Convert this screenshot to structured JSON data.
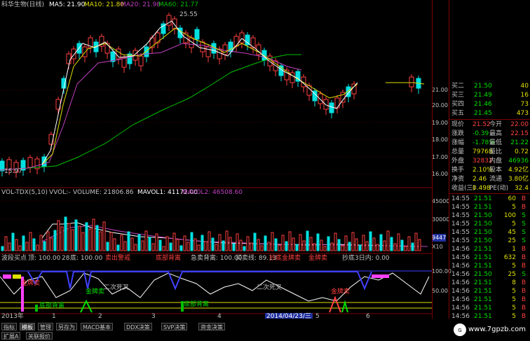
{
  "header": {
    "stock_name": "科华生物(日线)",
    "ma5": "MA5: 21.90",
    "ma10": "MA10: 21.80",
    "ma20": "MA20: 21.98",
    "ma60": "MA60: 21.77",
    "high_marker": "25.55",
    "low_marker": "15.97"
  },
  "price_axis": [
    "21.00",
    "20.00",
    "19.00",
    "18.00",
    "17.00",
    "16.00"
  ],
  "volume_panel": {
    "title": "VOL-TDX(5,10)",
    "vvol": "VVOL:-",
    "volume": "VOLUME: 21806.86",
    "mavol1": "MAVOL1: 41172.00",
    "mavol2": "MAVOL2: 46508.60",
    "axis": [
      "45000",
      "30000",
      "X10"
    ],
    "last_box": "9447"
  },
  "indicator_panel": {
    "l1": "波段买点",
    "l2": "顶: 100.00",
    "l3": "28",
    "l4": "底: 100.00",
    "l5": "卖出警戒",
    "l6": "底部背离",
    "l7": "急卖背离: 100.00",
    "l8": "买卖线: 89.13",
    "l9": "抄底",
    "l10": "金牌卖",
    "l11": "金牌卖",
    "l12": "抄底3日内: 0.00",
    "axis": [
      "100.00",
      "50.00"
    ],
    "ann1": "二次死叉",
    "ann2": "二次死叉",
    "ann3": "金牌卖",
    "ann4": "金牌卖",
    "ann5": "金牌卖",
    "ann6": "底部背离",
    "ann7": "底部背离"
  },
  "timeline": {
    "year": "2013年",
    "m1": "1",
    "m2": "2",
    "m3": "3",
    "m4": "4",
    "m5": "5",
    "m6": "6",
    "date_box": "2014/04/23/三"
  },
  "order_book": [
    {
      "label": "买二",
      "price": "21.50",
      "vol": "40"
    },
    {
      "label": "买三",
      "price": "21.49",
      "vol": "16"
    },
    {
      "label": "买四",
      "price": "21.46",
      "vol": "73"
    },
    {
      "label": "买五",
      "price": "21.45",
      "vol": "473"
    }
  ],
  "quote": [
    {
      "l1": "现价",
      "v1": "21.52",
      "c1": "#ff4040",
      "l2": "今开",
      "v2": "22.00",
      "c2": "#ff4040"
    },
    {
      "l1": "涨跌",
      "v1": "-0.39",
      "c1": "#00e000",
      "l2": "最高",
      "v2": "22.15",
      "c2": "#ff4040"
    },
    {
      "l1": "涨幅",
      "v1": "-1.78%",
      "c1": "#00e000",
      "l2": "最低",
      "v2": "21.22",
      "c2": "#00e000"
    },
    {
      "l1": "总量",
      "v1": "79768",
      "c1": "#e0e000",
      "l2": "量比",
      "v2": "0.72",
      "c2": "#e0e000"
    },
    {
      "l1": "外盘",
      "v1": "32832",
      "c1": "#ff4040",
      "l2": "内盘",
      "v2": "46936",
      "c2": "#00e000"
    },
    {
      "l1": "换手",
      "v1": "2.10%",
      "c1": "#e0e000",
      "l2": "股本",
      "v2": "4.92亿",
      "c2": "#e0e000"
    },
    {
      "l1": "净资",
      "v1": "2.46",
      "c1": "#e0e000",
      "l2": "流通",
      "v2": "3.80亿",
      "c2": "#e0e000"
    },
    {
      "l1": "收益(三)",
      "v1": "0.498",
      "c1": "#e0e000",
      "l2": "PE(动)",
      "v2": "32.4",
      "c2": "#e0e000"
    }
  ],
  "ticks": [
    {
      "t": "14:55",
      "p": "21.51",
      "v": "60",
      "bs": "B",
      "pc": "#00e000",
      "bc": "#ff4040"
    },
    {
      "t": "14:55",
      "p": "21.51",
      "v": "5",
      "bs": "B",
      "pc": "#00e000",
      "bc": "#ff4040"
    },
    {
      "t": "14:55",
      "p": "21.50",
      "v": "100",
      "bs": "S",
      "pc": "#00e000",
      "bc": "#00e000"
    },
    {
      "t": "14:55",
      "p": "21.50",
      "v": "5",
      "bs": "S",
      "pc": "#00e000",
      "bc": "#00e000"
    },
    {
      "t": "14:55",
      "p": "21.50",
      "v": "45",
      "bs": "S",
      "pc": "#00e000",
      "bc": "#00e000"
    },
    {
      "t": "14:55",
      "p": "21.50",
      "v": "25",
      "bs": "S",
      "pc": "#00e000",
      "bc": "#00e000"
    },
    {
      "t": "14:56",
      "p": "21.51",
      "v": "1",
      "bs": "B",
      "pc": "#00e000",
      "bc": "#ff4040"
    },
    {
      "t": "14:56",
      "p": "21.51",
      "v": "632",
      "bs": "B",
      "pc": "#00e000",
      "bc": "#ff4040"
    },
    {
      "t": "14:56",
      "p": "21.51",
      "v": "5",
      "bs": "B",
      "pc": "#00e000",
      "bc": "#ff4040"
    },
    {
      "t": "14:56",
      "p": "21.50",
      "v": "25",
      "bs": "S",
      "pc": "#00e000",
      "bc": "#00e000"
    },
    {
      "t": "14:56",
      "p": "21.51",
      "v": "8",
      "bs": "B",
      "pc": "#00e000",
      "bc": "#ff4040"
    },
    {
      "t": "14:56",
      "p": "21.51",
      "v": "5",
      "bs": "B",
      "pc": "#00e000",
      "bc": "#ff4040"
    },
    {
      "t": "14:56",
      "p": "21.51",
      "v": "5",
      "bs": "B",
      "pc": "#00e000",
      "bc": "#ff4040"
    },
    {
      "t": "14:56",
      "p": "21.51",
      "v": "5",
      "bs": "B",
      "pc": "#00e000",
      "bc": "#ff4040"
    },
    {
      "t": "14:56",
      "p": "21.51",
      "v": "5",
      "bs": "B",
      "pc": "#00e000",
      "bc": "#ff4040"
    }
  ],
  "tabs": [
    "指标",
    "模板",
    "管理",
    "另存为",
    "MACD基本",
    "DDX决策",
    "SVP决策",
    "资金决策"
  ],
  "tabs2": [
    "扩展A",
    "关联报价"
  ],
  "watermark": "www.7gpzb.com",
  "colors": {
    "up": "#ff4040",
    "down": "#00e0e0",
    "ma5": "#ffffff",
    "ma10": "#e0e000",
    "ma20": "#c040c0",
    "ma60": "#00c000",
    "grid": "#800000"
  }
}
